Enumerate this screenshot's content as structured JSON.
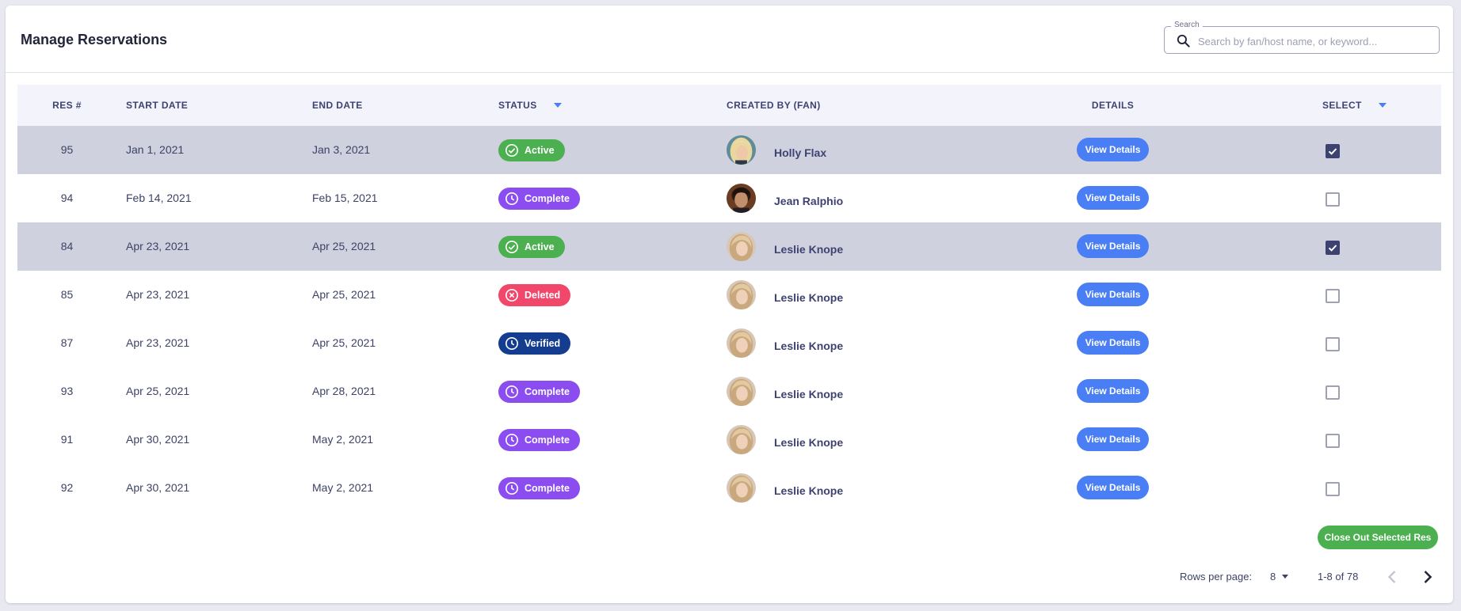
{
  "header": {
    "title": "Manage Reservations",
    "search_label": "Search",
    "search_placeholder": "Search by fan/host name, or keyword...",
    "search_value": ""
  },
  "table": {
    "columns": {
      "res": "RES #",
      "start": "START DATE",
      "end": "END DATE",
      "status": "STATUS",
      "fan": "CREATED BY (FAN)",
      "details": "DETAILS",
      "select": "SELECT"
    },
    "details_label": "View Details",
    "rows": [
      {
        "res": "95",
        "start": "Jan 1, 2021",
        "end": "Jan 3, 2021",
        "status": "Active",
        "status_kind": "active",
        "fan": "Holly Flax",
        "avatar": "holly",
        "selected": true
      },
      {
        "res": "94",
        "start": "Feb 14, 2021",
        "end": "Feb 15, 2021",
        "status": "Complete",
        "status_kind": "complete",
        "fan": "Jean Ralphio",
        "avatar": "jean",
        "selected": false
      },
      {
        "res": "84",
        "start": "Apr 23, 2021",
        "end": "Apr 25, 2021",
        "status": "Active",
        "status_kind": "active",
        "fan": "Leslie Knope",
        "avatar": "leslie",
        "selected": true
      },
      {
        "res": "85",
        "start": "Apr 23, 2021",
        "end": "Apr 25, 2021",
        "status": "Deleted",
        "status_kind": "deleted",
        "fan": "Leslie Knope",
        "avatar": "leslie",
        "selected": false
      },
      {
        "res": "87",
        "start": "Apr 23, 2021",
        "end": "Apr 25, 2021",
        "status": "Verified",
        "status_kind": "verified",
        "fan": "Leslie Knope",
        "avatar": "leslie",
        "selected": false
      },
      {
        "res": "93",
        "start": "Apr 25, 2021",
        "end": "Apr 28, 2021",
        "status": "Complete",
        "status_kind": "complete",
        "fan": "Leslie Knope",
        "avatar": "leslie",
        "selected": false
      },
      {
        "res": "91",
        "start": "Apr 30, 2021",
        "end": "May 2, 2021",
        "status": "Complete",
        "status_kind": "complete",
        "fan": "Leslie Knope",
        "avatar": "leslie",
        "selected": false
      },
      {
        "res": "92",
        "start": "Apr 30, 2021",
        "end": "May 2, 2021",
        "status": "Complete",
        "status_kind": "complete",
        "fan": "Leslie Knope",
        "avatar": "leslie",
        "selected": false
      }
    ]
  },
  "actions": {
    "close_out_label": "Close Out Selected Res"
  },
  "pagination": {
    "rows_per_page_label": "Rows per page:",
    "rows_per_page_value": "8",
    "range_label": "1-8 of 78"
  },
  "colors": {
    "accent": "#4a7ef5",
    "active": "#4caf50",
    "complete": "#8b4cf0",
    "deleted": "#f0476b",
    "verified": "#143d8f",
    "selected_row": "#cfd1de"
  }
}
